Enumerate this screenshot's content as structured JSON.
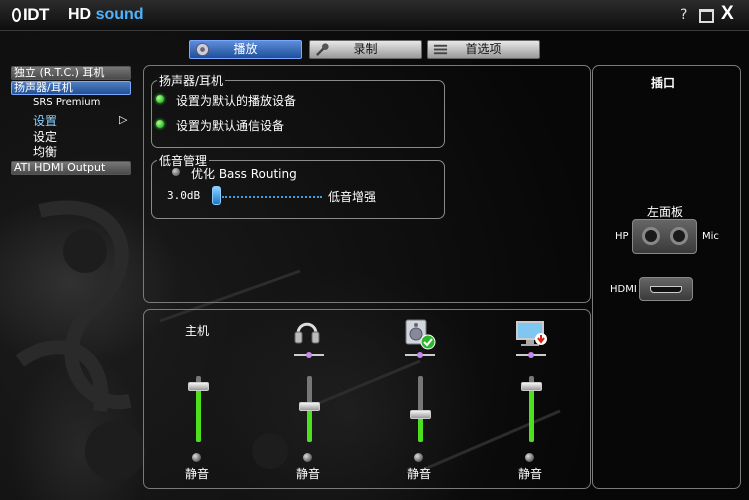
{
  "titlebar": {
    "brand": "IDT",
    "product_hd": "HD",
    "product_sound": "sound",
    "help_label": "?",
    "close_label": "X"
  },
  "tabs": [
    {
      "label": "播放",
      "active": true
    },
    {
      "label": "录制",
      "active": false
    },
    {
      "label": "首选项",
      "active": false
    }
  ],
  "sidebar": {
    "items": [
      {
        "label": "独立 (R.T.C.) 耳机",
        "selected": false
      },
      {
        "label": "扬声器/耳机",
        "selected": true
      },
      {
        "label": "SRS Premium"
      },
      {
        "label": "设置",
        "active": true,
        "arrow": "▷"
      },
      {
        "label": "设定"
      },
      {
        "label": "均衡"
      },
      {
        "label": "ATI HDMI Output",
        "selected": false
      }
    ]
  },
  "speaker_group": {
    "title": "扬声器/耳机",
    "options": [
      {
        "label": "设置为默认的播放设备",
        "led": "on"
      },
      {
        "label": "设置为默认通信设备",
        "led": "on"
      }
    ]
  },
  "bass_group": {
    "title": "低音管理",
    "optimize_label": "优化 Bass Routing",
    "value_label": "3.0dB",
    "slider_fraction": 0.0,
    "boost_label": "低音增强"
  },
  "mixer": {
    "channels": [
      {
        "label": "主机",
        "icon": "master",
        "level": 0.85,
        "mute_label": "静音"
      },
      {
        "label": "",
        "icon": "headphones-icon",
        "level": 0.55,
        "mute_label": "静音"
      },
      {
        "label": "",
        "icon": "speaker-check-icon",
        "level": 0.42,
        "mute_label": "静音"
      },
      {
        "label": "",
        "icon": "monitor-download-icon",
        "level": 0.85,
        "mute_label": "静音"
      }
    ]
  },
  "jacks": {
    "title": "插口",
    "front_panel_label": "左面板",
    "hp_label": "HP",
    "mic_label": "Mic",
    "hdmi_label": "HDMI"
  },
  "colors": {
    "accent_blue": "#2a5ea8",
    "led_green": "#2fbf2f",
    "slider_fill": "#4de01c",
    "hd_sound_blue": "#4fb4ff"
  }
}
